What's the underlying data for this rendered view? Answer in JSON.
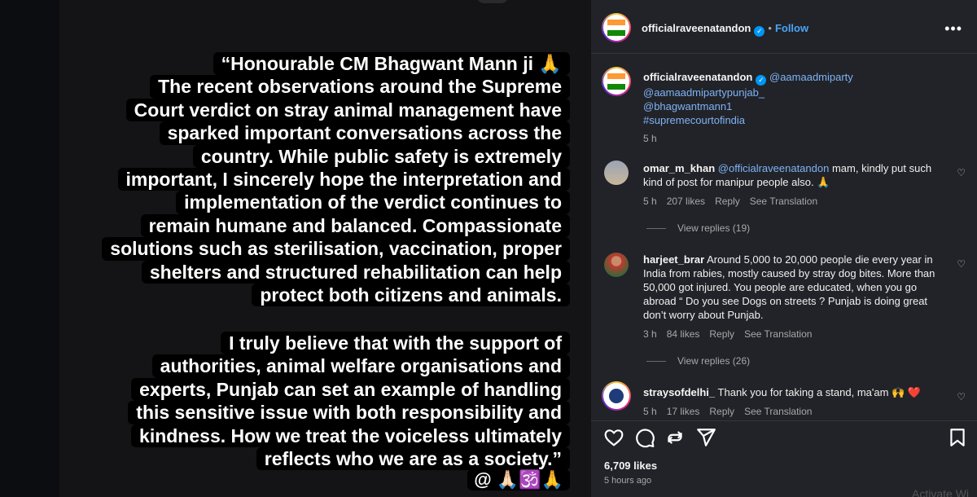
{
  "post": {
    "caption_lines_1": [
      "“Honourable CM Bhagwant Mann ji 🙏",
      "The recent observations around the Supreme",
      "Court verdict on stray animal management have",
      "sparked important conversations across the",
      "country. While public safety is extremely",
      "important, I sincerely hope the interpretation and",
      "implementation of the verdict continues to",
      "remain humane and balanced. Compassionate",
      "solutions such as sterilisation, vaccination, proper",
      "shelters and structured rehabilitation can help",
      "protect both citizens and animals."
    ],
    "caption_lines_2": [
      "I truly believe that with the support of",
      "authorities, animal welfare organisations and",
      "experts, Punjab can set an example of handling",
      "this sensitive issue with both responsibility and",
      "kindness. How we treat the voiceless ultimately",
      "reflects who we are as a society.”"
    ],
    "emoji_row": "🙏🏻🕉️🙏"
  },
  "header": {
    "username": "officialraveenatandon",
    "dot": "•",
    "follow_label": "Follow"
  },
  "caption": {
    "username": "officialraveenatandon",
    "mention1": "@aamaadmiparty",
    "mention2": "@aamaadmipartypunjab_",
    "mention3": "@bhagwantmann1",
    "hashtag": "#supremecourtofindia",
    "time": "5 h"
  },
  "comments": [
    {
      "username": "omar_m_khan",
      "mention": "@officialraveenatandon",
      "text_line1": "mam, kindly put such",
      "text_line2": "kind of post for manipur people also. 🙏",
      "time": "5 h",
      "likes": "207 likes",
      "reply": "Reply",
      "translate": "See Translation",
      "view_replies": "View replies (19)"
    },
    {
      "username": "harjeet_brar",
      "text_line1": "Around 5,000 to 20,000 people die every year in",
      "text_line2": "India from rabies, mostly caused by stray dog bites. More than",
      "text_line3": "50,000 got injured. You people are educated, when you go",
      "text_line4": "abroad “ Do you see Dogs on streets ? Punjab is doing great",
      "text_line5": "don’t worry about Punjab.",
      "time": "3 h",
      "likes": "84 likes",
      "reply": "Reply",
      "translate": "See Translation",
      "view_replies": "View replies (26)"
    },
    {
      "username": "straysofdelhi_",
      "text_line1": "Thank you for taking a stand, ma'am 🙌 ❤️",
      "time": "5 h",
      "likes": "17 likes",
      "reply": "Reply",
      "translate": "See Translation"
    }
  ],
  "footer": {
    "likes": "6,709 likes",
    "ago": "5 hours ago"
  },
  "watermark": "Activate Wi"
}
